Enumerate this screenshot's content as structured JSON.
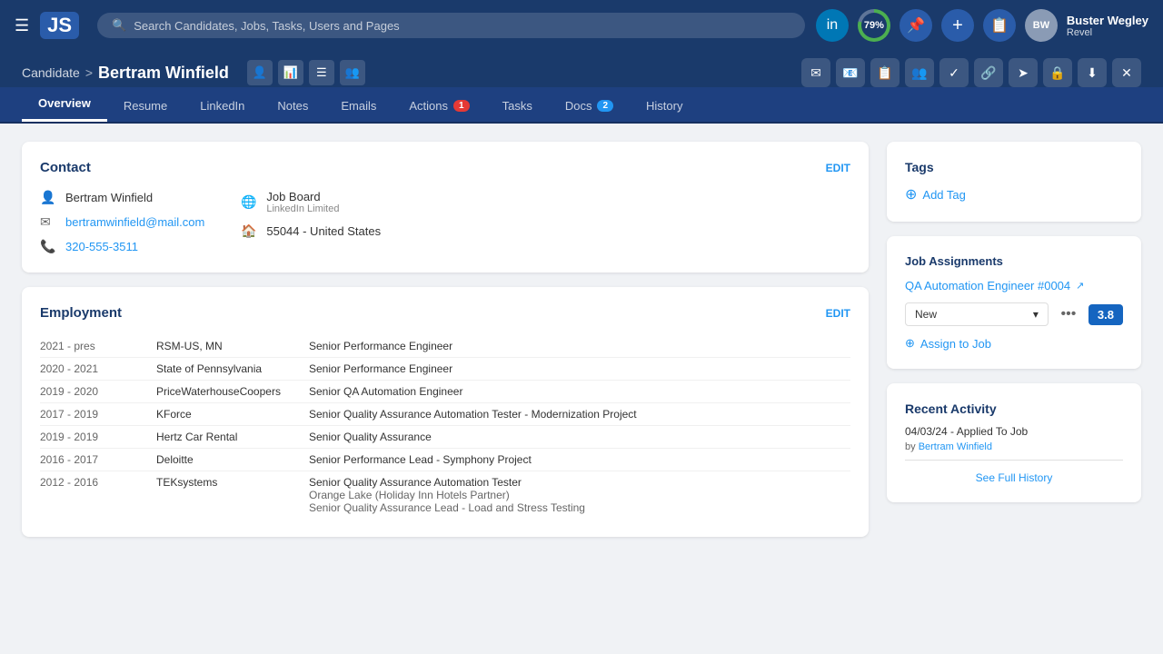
{
  "app": {
    "logo": "JS",
    "search_placeholder": "Search Candidates, Jobs, Tasks, Users and Pages"
  },
  "topnav": {
    "linkedin_icon": "in",
    "progress_pct": "79%",
    "add_label": "+",
    "user": {
      "name": "Buster Wegley",
      "subtitle": "Revel",
      "avatar_initials": "BW"
    }
  },
  "breadcrumb": {
    "parent": "Candidate",
    "separator": ">",
    "current": "Bertram Winfield"
  },
  "tabs": [
    {
      "label": "Overview",
      "active": true,
      "badge": null
    },
    {
      "label": "Resume",
      "active": false,
      "badge": null
    },
    {
      "label": "LinkedIn",
      "active": false,
      "badge": null
    },
    {
      "label": "Notes",
      "active": false,
      "badge": null
    },
    {
      "label": "Emails",
      "active": false,
      "badge": null
    },
    {
      "label": "Actions",
      "active": false,
      "badge": "1"
    },
    {
      "label": "Tasks",
      "active": false,
      "badge": null
    },
    {
      "label": "Docs",
      "active": false,
      "badge": "2",
      "badge_type": "blue"
    },
    {
      "label": "History",
      "active": false,
      "badge": null
    }
  ],
  "contact": {
    "section_title": "Contact",
    "edit_label": "EDIT",
    "name": "Bertram Winfield",
    "email": "bertramwinfield@mail.com",
    "phone": "320-555-3511",
    "source_label": "Job Board",
    "source_sub": "LinkedIn Limited",
    "location": "55044 - United States"
  },
  "employment": {
    "section_title": "Employment",
    "edit_label": "EDIT",
    "rows": [
      {
        "dates": "2021 - pres",
        "company": "RSM-US, MN",
        "title": "Senior Performance Engineer"
      },
      {
        "dates": "2020 - 2021",
        "company": "State of Pennsylvania",
        "title": "Senior Performance Engineer"
      },
      {
        "dates": "2019 - 2020",
        "company": "PriceWaterhouseCoopers",
        "title": "Senior QA Automation Engineer"
      },
      {
        "dates": "2017 - 2019",
        "company": "KForce",
        "title": "Senior Quality Assurance Automation Tester - Modernization Project"
      },
      {
        "dates": "2019 - 2019",
        "company": "Hertz Car Rental",
        "title": "Senior Quality Assurance"
      },
      {
        "dates": "2016 - 2017",
        "company": "Deloitte",
        "title": "Senior Performance Lead - Symphony Project"
      },
      {
        "dates": "2012 - 2016",
        "company": "TEKsystems",
        "title": "Senior Quality Assurance Automation Tester\nOrange Lake (Holiday Inn Hotels Partner)\nSenior Quality Assurance Lead - Load and Stress Testing"
      }
    ]
  },
  "tags": {
    "section_title": "Tags",
    "add_tag_label": "Add Tag"
  },
  "job_assignments": {
    "section_title": "Job Assignments",
    "job_link": "QA Automation Engineer #0004",
    "status": "New",
    "score": "3.8",
    "assign_label": "Assign to Job"
  },
  "recent_activity": {
    "section_title": "Recent Activity",
    "entry_date": "04/03/24 - Applied To Job",
    "entry_by": "by",
    "entry_person": "Bertram Winfield",
    "see_full_label": "See Full History"
  },
  "header_action_icons": [
    "✉",
    "📋",
    "👥",
    "✓",
    "🔗",
    "➤",
    "🔒",
    "⬇",
    "✕"
  ]
}
